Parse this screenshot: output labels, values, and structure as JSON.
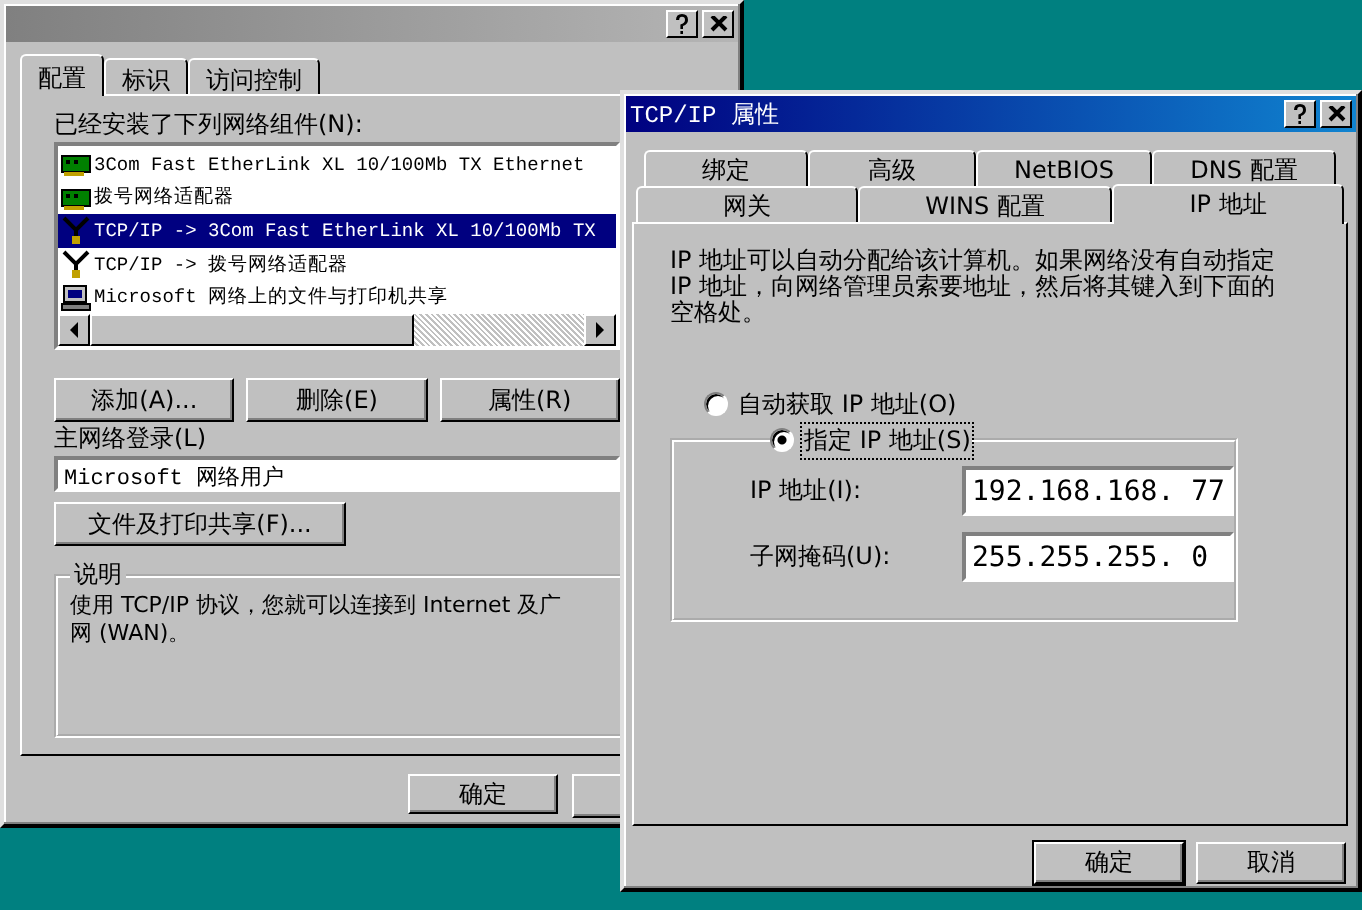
{
  "back_dialog": {
    "tabs": [
      {
        "label": "配置",
        "selected": true
      },
      {
        "label": "标识",
        "selected": false
      },
      {
        "label": "访问控制",
        "selected": false
      }
    ],
    "components_label": "已经安装了下列网络组件(N):",
    "components": [
      {
        "kind": "adapter",
        "label": "3Com Fast EtherLink XL 10/100Mb TX Ethernet",
        "selected": false
      },
      {
        "kind": "adapter",
        "label": "拨号网络适配器",
        "selected": false
      },
      {
        "kind": "protocol",
        "label": "TCP/IP -> 3Com Fast EtherLink XL 10/100Mb TX",
        "selected": true
      },
      {
        "kind": "protocol",
        "label": "TCP/IP -> 拨号网络适配器",
        "selected": false
      },
      {
        "kind": "service",
        "label": "Microsoft 网络上的文件与打印机共享",
        "selected": false
      }
    ],
    "component_buttons": [
      "添加(A)...",
      "删除(E)",
      "属性(R)"
    ],
    "logon_label": "主网络登录(L)",
    "logon_value": "Microsoft 网络用户",
    "sharing_button": "文件及打印共享(F)...",
    "description_title": "说明",
    "description_lines": [
      "使用 TCP/IP 协议，您就可以连接到 Internet 及广",
      "网 (WAN)。"
    ],
    "bottom_buttons": [
      {
        "label": "确定"
      },
      {
        "covered": true
      }
    ]
  },
  "front_dialog": {
    "title": "TCP/IP 属性",
    "tab_rows": [
      [
        {
          "label": "绑定",
          "selected": false
        },
        {
          "label": "高级",
          "selected": false
        },
        {
          "label": "NetBIOS",
          "selected": false
        },
        {
          "label": "DNS 配置",
          "selected": false
        }
      ],
      [
        {
          "label": "网关",
          "selected": false
        },
        {
          "label": "WINS 配置",
          "selected": false
        },
        {
          "label": "IP 地址",
          "selected": true
        }
      ]
    ],
    "description": "IP 地址可以自动分配给该计算机。如果网络没有自动指定 IP 地址，向网络管理员索要地址，然后将其键入到下面的空格处。",
    "radios": [
      {
        "label": "自动获取 IP 地址(O)",
        "selected": false
      },
      {
        "label": "指定 IP 地址(S)",
        "selected": true
      }
    ],
    "fields": [
      {
        "label": "IP 地址(I):",
        "value": "192.168.168. 77"
      },
      {
        "label": "子网掩码(U):",
        "value": "255.255.255. 0"
      }
    ],
    "buttons": [
      {
        "label": "确定",
        "default": true
      },
      {
        "label": "取消",
        "default": false
      }
    ]
  }
}
